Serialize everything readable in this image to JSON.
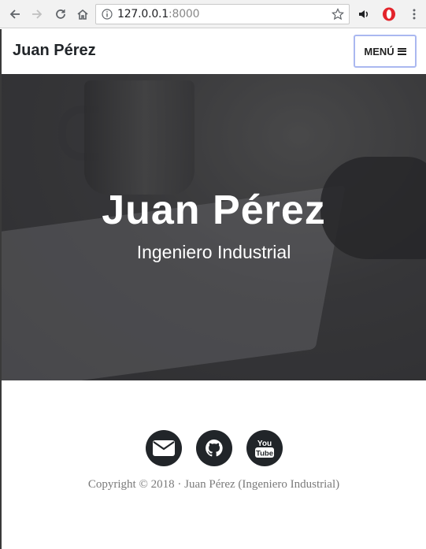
{
  "browser": {
    "url_host": "127.0.0.1",
    "url_port": ":8000"
  },
  "navbar": {
    "brand": "Juan Pérez",
    "menu_label": "MENÚ"
  },
  "hero": {
    "title": "Juan Pérez",
    "subtitle": "Ingeniero Industrial"
  },
  "footer": {
    "social": [
      {
        "icon": "envelope-icon",
        "label": "email"
      },
      {
        "icon": "github-icon",
        "label": "GitHub"
      },
      {
        "icon": "youtube-icon",
        "label": "YouTube"
      }
    ],
    "youtube_you": "You",
    "youtube_tube": "Tube",
    "copyright": "Copyright © 2018 · Juan Pérez (Ingeniero Industrial)"
  }
}
